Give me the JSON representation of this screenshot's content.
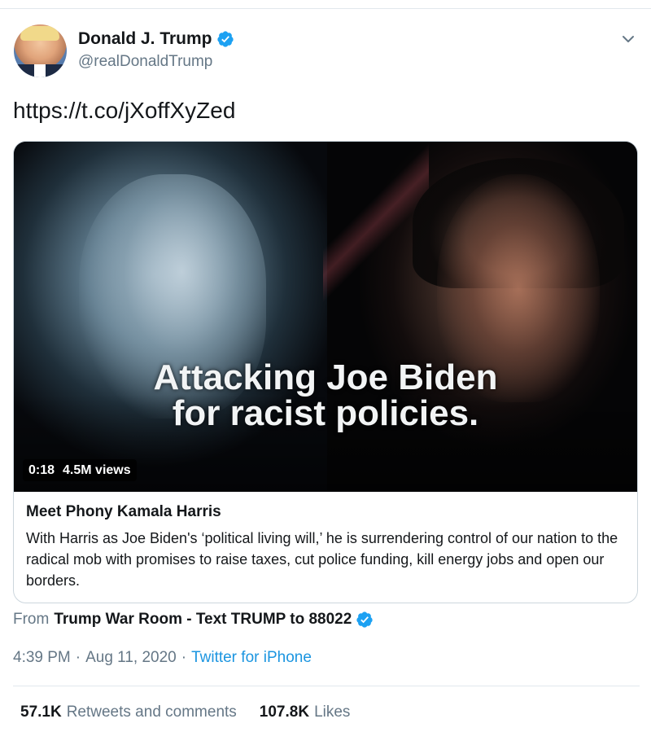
{
  "author": {
    "display_name": "Donald J. Trump",
    "handle": "@realDonaldTrump",
    "verified": true,
    "verified_color": "#1da1f2"
  },
  "tweet": {
    "text": "https://t.co/jXoffXyZed"
  },
  "media": {
    "headline_line1": "Attacking Joe Biden",
    "headline_line2": "for racist policies.",
    "duration": "0:18",
    "views": "4.5M views"
  },
  "card": {
    "title": "Meet Phony Kamala Harris",
    "description": "With Harris as Joe Biden's ‘political living will,’ he is surrendering control of our nation to the radical mob with promises to raise taxes, cut police funding, kill energy jobs and open our borders."
  },
  "source": {
    "from_label": "From",
    "name": "Trump War Room - Text TRUMP to 88022",
    "verified": true
  },
  "meta": {
    "time": "4:39 PM",
    "separator": "·",
    "date": "Aug 11, 2020",
    "client": "Twitter for iPhone",
    "link_color": "#1b95e0"
  },
  "stats": {
    "retweets_count": "57.1K",
    "retweets_label": "Retweets and comments",
    "likes_count": "107.8K",
    "likes_label": "Likes"
  },
  "icons": {
    "caret": "chevron-down-icon",
    "verified": "verified-badge-icon"
  }
}
